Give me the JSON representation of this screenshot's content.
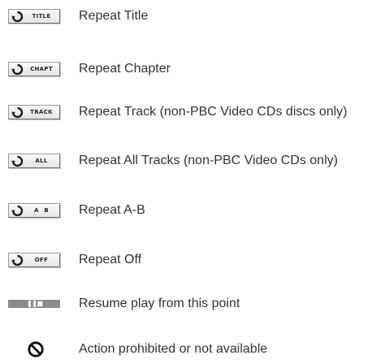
{
  "legend": {
    "items": [
      {
        "icon": "repeat-title-icon",
        "tag": "TITLE",
        "label": "Repeat Title"
      },
      {
        "icon": "repeat-chapter-icon",
        "tag": "CHAPT",
        "label": "Repeat Chapter"
      },
      {
        "icon": "repeat-track-icon",
        "tag": "TRACK",
        "label": "Repeat Track (non-PBC Video CDs discs only)"
      },
      {
        "icon": "repeat-all-icon",
        "tag": "ALL",
        "label": "Repeat All Tracks (non-PBC Video CDs only)"
      },
      {
        "icon": "repeat-ab-icon",
        "tag": "A B",
        "label": "Repeat A-B"
      },
      {
        "icon": "repeat-off-icon",
        "tag": "OFF",
        "label": "Repeat Off"
      },
      {
        "icon": "resume-play-icon",
        "tag": "",
        "label": "Resume play from this point"
      },
      {
        "icon": "prohibited-icon",
        "tag": "",
        "label": "Action prohibited or not available"
      }
    ]
  },
  "colors": {
    "text": "#333333",
    "badge_border": "#9a9a9a",
    "resume_bar": "#8c8c8c"
  }
}
